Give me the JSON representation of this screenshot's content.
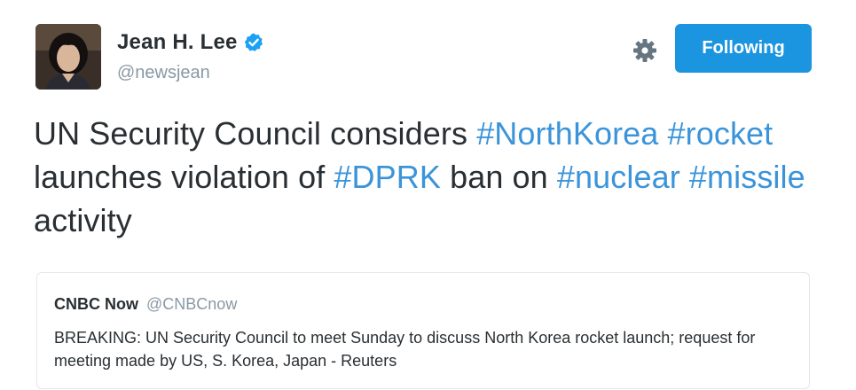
{
  "author": {
    "display_name": "Jean H. Lee",
    "handle": "@newsjean",
    "verified": true
  },
  "actions": {
    "follow_label": "Following",
    "settings_icon": "gear-icon"
  },
  "tweet": {
    "segments": [
      {
        "text": "UN Security Council considers ",
        "type": "text"
      },
      {
        "text": "#NorthKorea",
        "type": "hashtag"
      },
      {
        "text": " ",
        "type": "text"
      },
      {
        "text": "#rocket",
        "type": "hashtag"
      },
      {
        "text": " launches violation of ",
        "type": "text"
      },
      {
        "text": "#DPRK",
        "type": "hashtag"
      },
      {
        "text": " ban on ",
        "type": "text"
      },
      {
        "text": "#nuclear",
        "type": "hashtag"
      },
      {
        "text": " ",
        "type": "text"
      },
      {
        "text": "#missile",
        "type": "hashtag"
      },
      {
        "text": " activity",
        "type": "text"
      }
    ]
  },
  "quoted_tweet": {
    "name": "CNBC Now",
    "handle": "@CNBCnow",
    "text": "BREAKING: UN Security Council to meet Sunday to discuss North Korea rocket launch; request for meeting made by US, S. Korea, Japan - Reuters"
  },
  "colors": {
    "accent": "#1b95e0",
    "hashtag": "#3b94d9",
    "text": "#292f33",
    "muted": "#8899a6"
  }
}
